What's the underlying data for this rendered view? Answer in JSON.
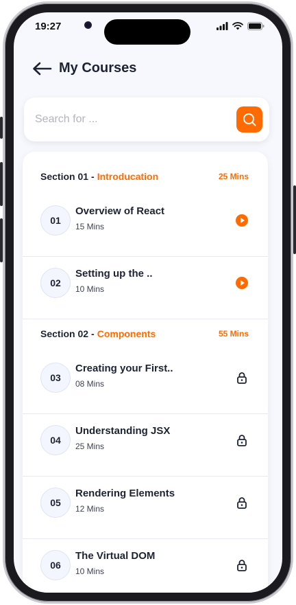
{
  "status_bar": {
    "time": "19:27"
  },
  "header": {
    "back_icon": "arrow-left-icon",
    "title": "My Courses"
  },
  "search": {
    "placeholder": "Search for ...",
    "value": "",
    "button_icon": "search-icon"
  },
  "colors": {
    "accent": "#ff6b00",
    "background": "#f6f8fd",
    "text": "#1d2333"
  },
  "sections": [
    {
      "label": "Section 01",
      "name": "Introducation",
      "duration": "25 Mins",
      "lessons": [
        {
          "number": "01",
          "title": "Overview of React",
          "duration": "15 Mins",
          "status_icon": "play-icon"
        },
        {
          "number": "02",
          "title": "Setting up the ..",
          "duration": "10 Mins",
          "status_icon": "play-icon"
        }
      ]
    },
    {
      "label": "Section 02",
      "name": "Components",
      "duration": "55 Mins",
      "lessons": [
        {
          "number": "03",
          "title": "Creating your First..",
          "duration": "08 Mins",
          "status_icon": "lock-icon"
        },
        {
          "number": "04",
          "title": "Understanding JSX",
          "duration": "25 Mins",
          "status_icon": "lock-icon"
        },
        {
          "number": "05",
          "title": "Rendering Elements",
          "duration": "12 Mins",
          "status_icon": "lock-icon"
        },
        {
          "number": "06",
          "title": "The Virtual DOM",
          "duration": "10 Mins",
          "status_icon": "lock-icon"
        }
      ]
    }
  ]
}
